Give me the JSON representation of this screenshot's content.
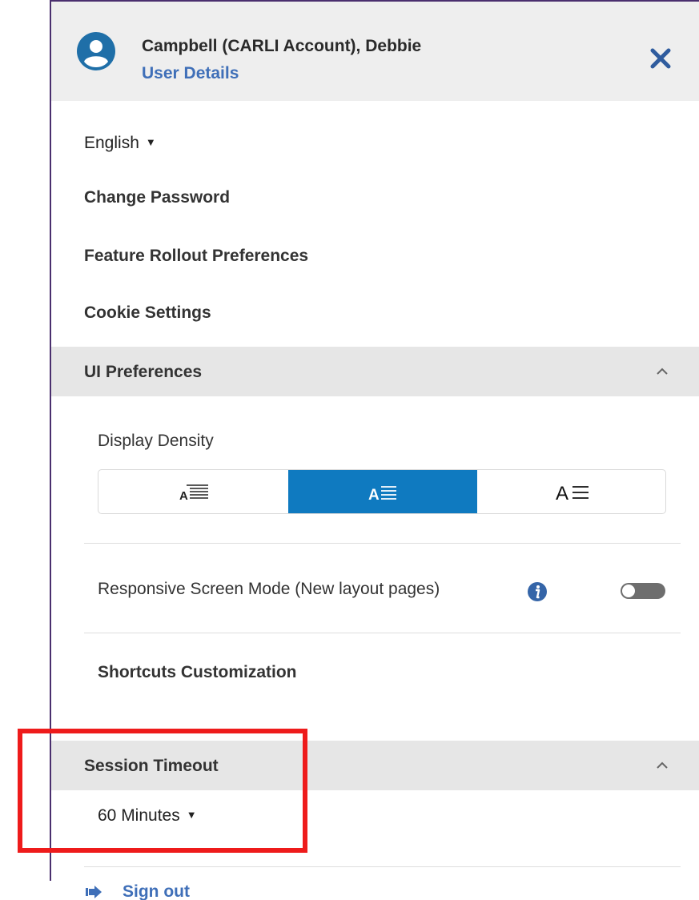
{
  "user": {
    "name": "Campbell (CARLI Account), Debbie",
    "details_link": "User Details"
  },
  "menu": {
    "language": "English",
    "change_password": "Change Password",
    "feature_rollout": "Feature Rollout Preferences",
    "cookie_settings": "Cookie Settings"
  },
  "ui_preferences": {
    "title": "UI Preferences",
    "display_density_label": "Display Density",
    "density_options": [
      "compact",
      "default",
      "comfortable"
    ],
    "density_selected": "default",
    "responsive_label": "Responsive Screen Mode (New layout pages)",
    "responsive_enabled": false,
    "shortcuts_label": "Shortcuts Customization"
  },
  "session_timeout": {
    "title": "Session Timeout",
    "selected": "60 Minutes"
  },
  "sign_out": "Sign out",
  "colors": {
    "accent": "#0f7ac0",
    "link": "#3f6fb8",
    "highlight": "#ee1b1b",
    "header_bg": "#eeeeee",
    "section_bg": "#e6e6e6"
  }
}
